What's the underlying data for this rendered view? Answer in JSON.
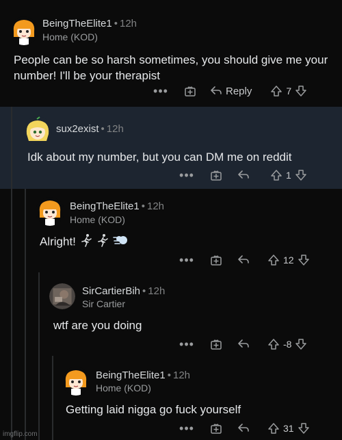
{
  "comments": [
    {
      "username": "BeingTheElite1",
      "time": "12h",
      "flair": "Home (KOD)",
      "body": "People can be so harsh sometimes, you should give me your number! I'll be your therapist",
      "reply_label": "Reply",
      "votes": "7",
      "avatar": "orange-hair-girl-avatar"
    },
    {
      "username": "sux2exist",
      "time": "12h",
      "body": "Idk about my number, but you can DM me on reddit",
      "votes": "1",
      "avatar": "blonde-girl-avatar"
    },
    {
      "username": "BeingTheElite1",
      "time": "12h",
      "flair": "Home (KOD)",
      "body": "Alright!",
      "emojis": [
        "running-man-emoji",
        "running-man-emoji",
        "dash-emoji"
      ],
      "votes": "12",
      "avatar": "orange-hair-girl-avatar"
    },
    {
      "username": "SirCartierBih",
      "time": "12h",
      "flair": "Sir Cartier",
      "body": "wtf are you doing",
      "votes": "-8",
      "avatar": "photo-avatar"
    },
    {
      "username": "BeingTheElite1",
      "time": "12h",
      "flair": "Home (KOD)",
      "body": "Getting laid nigga go fuck yourself",
      "votes": "31",
      "avatar": "orange-hair-girl-avatar"
    }
  ],
  "icons": {
    "more": "more-options-icon",
    "award": "award-icon",
    "reply": "reply-arrow-icon",
    "upvote": "upvote-arrow-icon",
    "downvote": "downvote-arrow-icon"
  },
  "watermark": "imgflip.com"
}
